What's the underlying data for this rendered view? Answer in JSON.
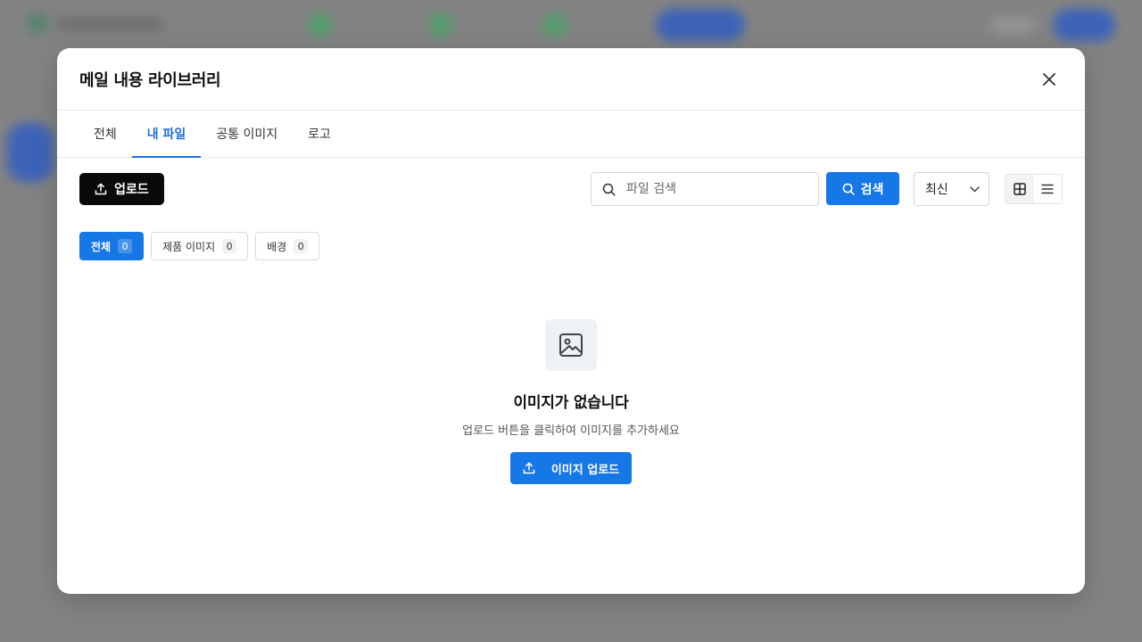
{
  "modal": {
    "title": "메일 내용 라이브러리",
    "close_icon": "close-icon"
  },
  "tabs": [
    {
      "label": "전체",
      "active": false
    },
    {
      "label": "내 파일",
      "active": true
    },
    {
      "label": "공통 이미지",
      "active": false
    },
    {
      "label": "로고",
      "active": false
    }
  ],
  "toolbar": {
    "upload_label": "업로드",
    "upload_icon": "upload-icon",
    "search_placeholder": "파일 검색",
    "search_icon": "search-icon",
    "search_button_label": "검색",
    "sort_value": "최신",
    "sort_icon": "chevron-down-icon",
    "view_modes": [
      "grid-icon",
      "list-icon"
    ],
    "active_view": "grid"
  },
  "chips": [
    {
      "label": "전체",
      "count": "0",
      "active": true
    },
    {
      "label": "제품 이미지",
      "count": "0",
      "active": false
    },
    {
      "label": "배경",
      "count": "0",
      "active": false
    }
  ],
  "empty_state": {
    "icon": "image-icon",
    "title": "이미지가 없습니다",
    "description": "업로드 버튼을 클릭하여 이미지를 추가하세요",
    "button_label": "이미지 업로드",
    "button_icon": "upload-icon"
  },
  "colors": {
    "accent": "#1677e6",
    "tab_active": "#1f6fd6",
    "upload_button": "#0a0a0a",
    "backdrop": "#7d7d7d"
  }
}
